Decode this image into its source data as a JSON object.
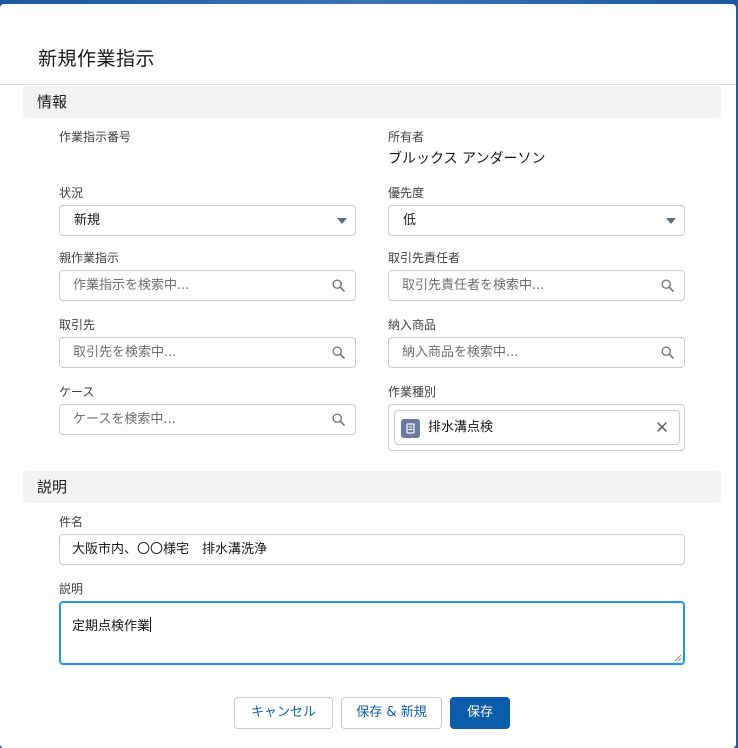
{
  "dialog": {
    "title": "新規作業指示"
  },
  "sections": {
    "info": "情報",
    "description": "説明"
  },
  "fields": {
    "work_order_number": {
      "label": "作業指示番号"
    },
    "owner": {
      "label": "所有者",
      "value": "ブルックス アンダーソン"
    },
    "status": {
      "label": "状況",
      "value": "新規"
    },
    "priority": {
      "label": "優先度",
      "value": "低"
    },
    "parent_work_order": {
      "label": "親作業指示",
      "placeholder": "作業指示を検索中..."
    },
    "contact": {
      "label": "取引先責任者",
      "placeholder": "取引先責任者を検索中..."
    },
    "account": {
      "label": "取引先",
      "placeholder": "取引先を検索中..."
    },
    "asset": {
      "label": "納入商品",
      "placeholder": "納入商品を検索中..."
    },
    "case": {
      "label": "ケース",
      "placeholder": "ケースを検索中..."
    },
    "work_type": {
      "label": "作業種別",
      "value": "排水溝点検"
    },
    "subject": {
      "label": "件名",
      "value": "大阪市内、〇〇様宅　排水溝洗浄"
    },
    "description": {
      "label": "説明",
      "value": "定期点検作業"
    }
  },
  "buttons": {
    "cancel": "キャンセル",
    "save_new": "保存 & 新規",
    "save": "保存"
  },
  "colors": {
    "brand": "#0b5cab",
    "focus": "#1b96ff",
    "section_bg": "#f3f3f3"
  },
  "icons": {
    "lookup": "search-icon",
    "picklist": "chevron-down-icon",
    "pill_remove": "close-icon",
    "work_type": "work-type-icon"
  }
}
